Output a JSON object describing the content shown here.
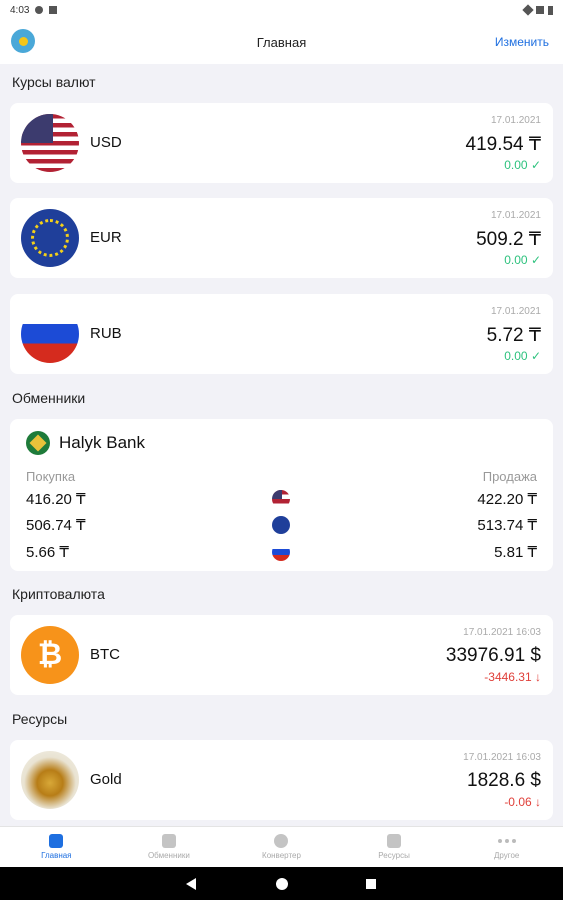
{
  "status_bar": {
    "time": "4:03"
  },
  "header": {
    "title": "Главная",
    "edit_label": "Изменить",
    "flag_icon": "kazakhstan-flag-icon"
  },
  "sections": {
    "rates": "Курсы валют",
    "exchangers": "Обменники",
    "crypto": "Криптовалюта",
    "resources": "Ресурсы"
  },
  "rates": [
    {
      "code": "USD",
      "date": "17.01.2021",
      "value": "419.54 ₸",
      "delta": "0.00 ✓",
      "icon": "us-flag-icon"
    },
    {
      "code": "EUR",
      "date": "17.01.2021",
      "value": "509.2 ₸",
      "delta": "0.00 ✓",
      "icon": "eu-flag-icon"
    },
    {
      "code": "RUB",
      "date": "17.01.2021",
      "value": "5.72 ₸",
      "delta": "0.00 ✓",
      "icon": "russia-flag-icon"
    }
  ],
  "exchanger": {
    "bank_name": "Halyk Bank",
    "buy_label": "Покупка",
    "sell_label": "Продажа",
    "rows": [
      {
        "buy": "416.20 ₸",
        "sell": "422.20 ₸",
        "icon": "us-flag-icon"
      },
      {
        "buy": "506.74 ₸",
        "sell": "513.74 ₸",
        "icon": "eu-flag-icon"
      },
      {
        "buy": "5.66 ₸",
        "sell": "5.81 ₸",
        "icon": "russia-flag-icon"
      }
    ]
  },
  "crypto": [
    {
      "code": "BTC",
      "symbol": "₿",
      "date": "17.01.2021 16:03",
      "value": "33976.91 $",
      "delta": "-3446.31 ↓",
      "icon": "bitcoin-icon"
    }
  ],
  "resources": [
    {
      "code": "Gold",
      "date": "17.01.2021 16:03",
      "value": "1828.6 $",
      "delta": "-0.06 ↓",
      "icon": "gold-icon"
    }
  ],
  "tabs": [
    {
      "label": "Главная",
      "active": true
    },
    {
      "label": "Обменники",
      "active": false
    },
    {
      "label": "Конвертер",
      "active": false
    },
    {
      "label": "Ресурсы",
      "active": false
    },
    {
      "label": "Другое",
      "active": false
    }
  ],
  "colors": {
    "accent": "#1e6fe0",
    "positive": "#2ec27e",
    "negative": "#e0403a"
  }
}
